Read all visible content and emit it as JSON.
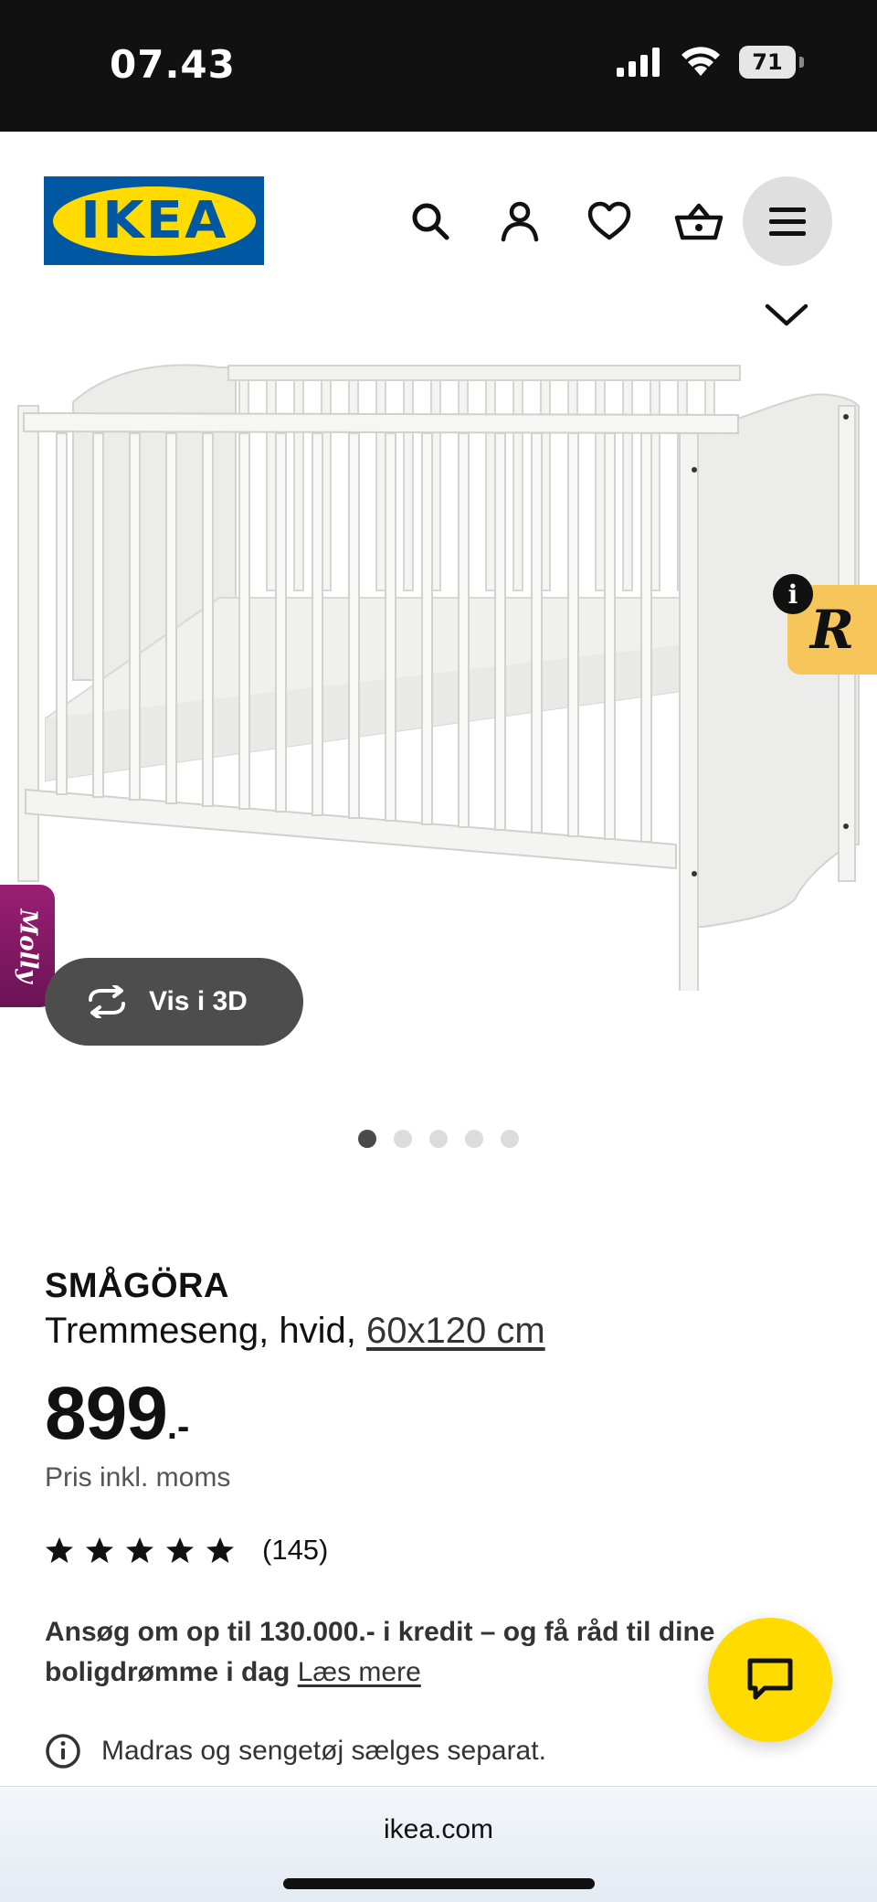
{
  "status_bar": {
    "time": "07.43",
    "battery": "71"
  },
  "header": {
    "logo_text": "IKEA",
    "icons": [
      "search-icon",
      "user-icon",
      "heart-icon",
      "basket-icon",
      "menu-icon"
    ]
  },
  "gallery": {
    "view_3d_label": "Vis i 3D",
    "slide_count": 5,
    "active_slide": 1,
    "side_badge_letter": "R",
    "info_letter": "i",
    "side_tab_label": "Molly"
  },
  "product": {
    "name": "SMÅGÖRA",
    "description_prefix": "Tremmeseng, hvid,",
    "size": "60x120 cm",
    "price": "899",
    "price_suffix": ".-",
    "price_note": "Pris inkl. moms",
    "rating_value": 5,
    "rating_count": "(145)"
  },
  "credit": {
    "text": "Ansøg om op til 130.000.- i kredit – og få råd til dine boligdrømme i dag",
    "link": "Læs mere"
  },
  "notice": {
    "text": "Madras og sengetøj sælges separat."
  },
  "browser": {
    "url": "ikea.com"
  },
  "colors": {
    "ikea_blue": "#0058a3",
    "ikea_yellow": "#ffdb00",
    "dark_button": "#4d4d4d"
  }
}
